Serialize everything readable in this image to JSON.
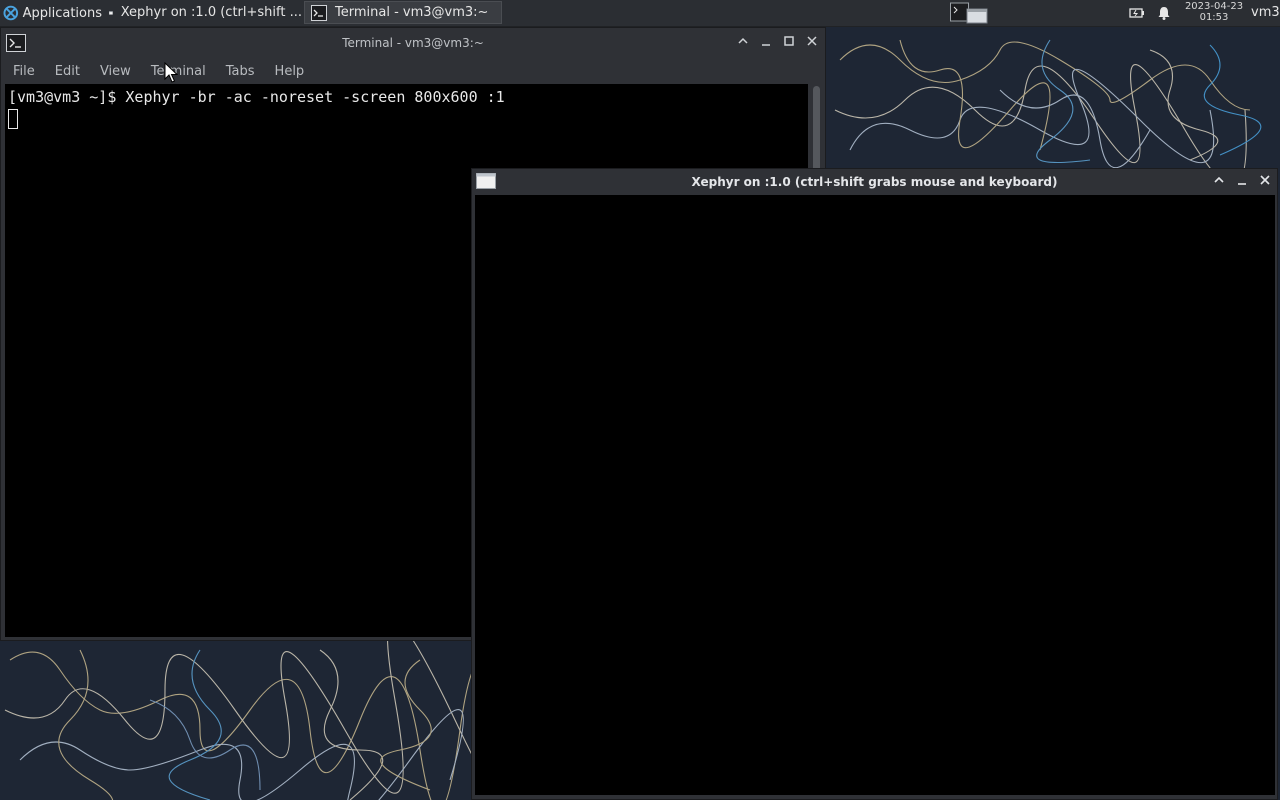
{
  "panel": {
    "applications_label": "Applications",
    "tasks": [
      {
        "label": "Xephyr on :1.0 (ctrl+shift ..."
      },
      {
        "label": "Terminal - vm3@vm3:~"
      }
    ],
    "clock_date": "2023-04-23",
    "clock_time": "01:53",
    "user": "vm3"
  },
  "terminal": {
    "title": "Terminal - vm3@vm3:~",
    "menu": [
      "File",
      "Edit",
      "View",
      "Terminal",
      "Tabs",
      "Help"
    ],
    "prompt_line": "[vm3@vm3 ~]$ Xephyr -br -ac -noreset -screen 800x600 :1"
  },
  "xephyr": {
    "title": "Xephyr on :1.0 (ctrl+shift grabs mouse and keyboard)"
  },
  "icons": {
    "window_controls": [
      "chevron-up-icon",
      "minimize-icon",
      "maximize-icon",
      "close-icon"
    ]
  },
  "colors": {
    "panel_bg": "#2b2e33",
    "window_bg": "#2f3136",
    "terminal_bg": "#000000",
    "accent": "#4aa3df"
  }
}
